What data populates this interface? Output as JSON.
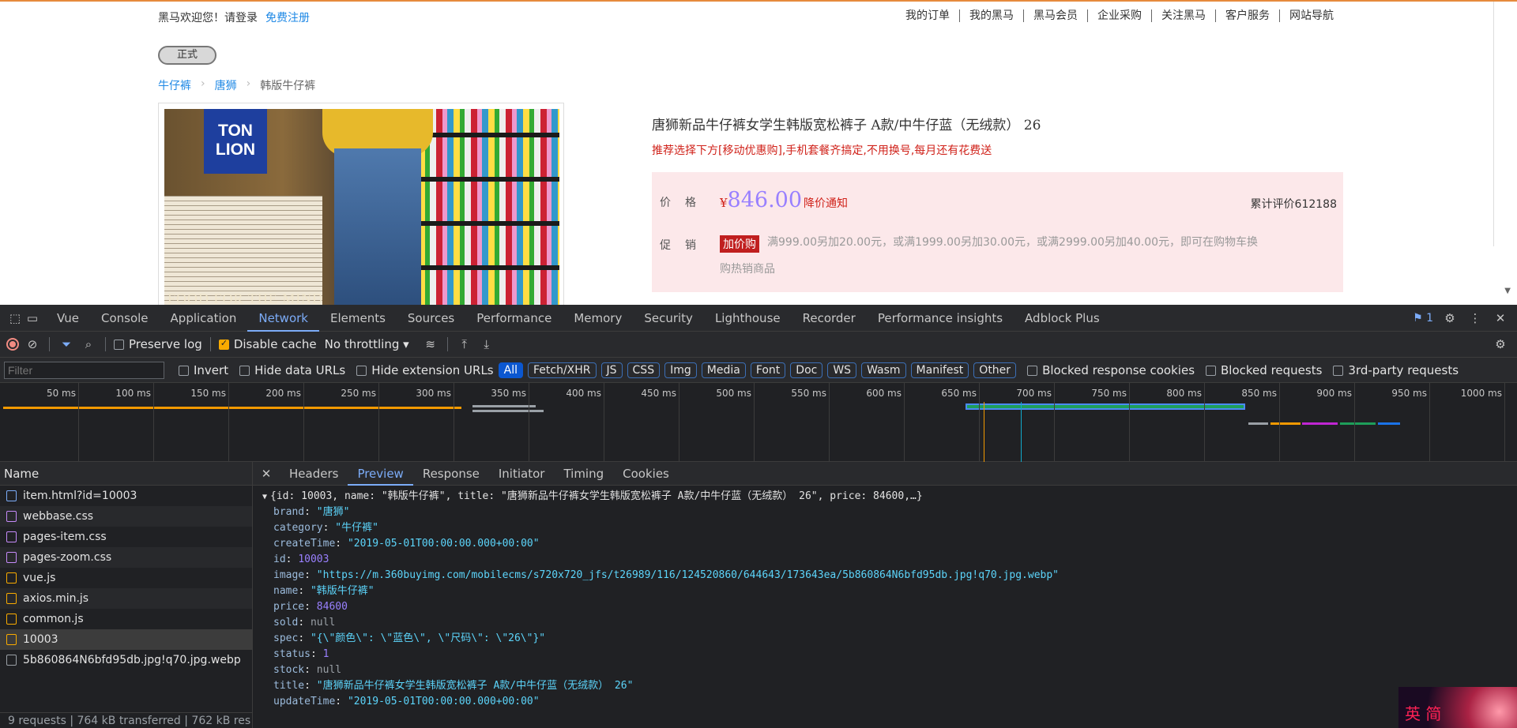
{
  "site": {
    "welcome": "黑马欢迎您！请登录",
    "register": "免费注册",
    "nav": [
      "我的订单",
      "我的黑马",
      "黑马会员",
      "企业采购",
      "关注黑马",
      "客户服务",
      "网站导航"
    ],
    "env_button": "正式",
    "breadcrumb": [
      "牛仔裤",
      "唐狮",
      "韩版牛仔裤"
    ],
    "image": {
      "logo_line1": "TON",
      "logo_line2": "LION",
      "bottom_text": "FOOD FOR THE MIND"
    },
    "product_title": "唐狮新品牛仔裤女学生韩版宽松裤子 A款/中牛仔蓝（无绒款） 26",
    "promo_line": "推荐选择下方[移动优惠购],手机套餐齐搞定,不用换号,每月还有花费送",
    "price_label": "价格",
    "currency": "¥",
    "price": "846.00",
    "price_notice": "降价通知",
    "reviews": "累计评价612188",
    "promo_label": "促销",
    "promo_tag": "加价购",
    "promo_text": "满999.00另加20.00元，或满1999.00另加30.00元，或满2999.00另加40.00元，即可在购物车换 购热销商品"
  },
  "devtools": {
    "tabs": [
      "Vue",
      "Console",
      "Application",
      "Network",
      "Elements",
      "Sources",
      "Performance",
      "Memory",
      "Security",
      "Lighthouse",
      "Recorder",
      "Performance insights",
      "Adblock Plus"
    ],
    "active_tab": "Network",
    "issues_count": "1",
    "toolbar": {
      "preserve_log": "Preserve log",
      "disable_cache": "Disable cache",
      "throttling": "No throttling"
    },
    "filter": {
      "placeholder": "Filter",
      "invert": "Invert",
      "hide_data_urls": "Hide data URLs",
      "hide_extension_urls": "Hide extension URLs",
      "types": [
        "All",
        "Fetch/XHR",
        "JS",
        "CSS",
        "Img",
        "Media",
        "Font",
        "Doc",
        "WS",
        "Wasm",
        "Manifest",
        "Other"
      ],
      "blocked_cookies": "Blocked response cookies",
      "blocked_requests": "Blocked requests",
      "third_party": "3rd-party requests"
    },
    "timeline_ticks": [
      "50 ms",
      "100 ms",
      "150 ms",
      "200 ms",
      "250 ms",
      "300 ms",
      "350 ms",
      "400 ms",
      "450 ms",
      "500 ms",
      "550 ms",
      "600 ms",
      "650 ms",
      "700 ms",
      "750 ms",
      "800 ms",
      "850 ms",
      "900 ms",
      "950 ms",
      "1000 ms"
    ],
    "name_header": "Name",
    "requests": [
      {
        "name": "item.html?id=10003",
        "type": "doc",
        "color": "#7cacf8"
      },
      {
        "name": "webbase.css",
        "type": "css",
        "color": "#c58af9"
      },
      {
        "name": "pages-item.css",
        "type": "css",
        "color": "#c58af9"
      },
      {
        "name": "pages-zoom.css",
        "type": "css",
        "color": "#c58af9"
      },
      {
        "name": "vue.js",
        "type": "js",
        "color": "#f9ab00"
      },
      {
        "name": "axios.min.js",
        "type": "js",
        "color": "#f9ab00"
      },
      {
        "name": "common.js",
        "type": "js",
        "color": "#f9ab00"
      },
      {
        "name": "10003",
        "type": "xhr",
        "color": "#f9ab00"
      },
      {
        "name": "5b860864N6bfd95db.jpg!q70.jpg.webp",
        "type": "img",
        "color": "#9aa0a6"
      }
    ],
    "status": "9 requests  |  764 kB transferred  |  762 kB res",
    "detail_tabs": [
      "Headers",
      "Preview",
      "Response",
      "Initiator",
      "Timing",
      "Cookies"
    ],
    "active_detail_tab": "Preview",
    "preview": {
      "summary": "{id: 10003, name: \"韩版牛仔裤\", title: \"唐狮新品牛仔裤女学生韩版宽松裤子 A款/中牛仔蓝（无绒款） 26\", price: 84600,…}",
      "fields": [
        {
          "key": "brand",
          "value": "\"唐狮\"",
          "kind": "str"
        },
        {
          "key": "category",
          "value": "\"牛仔裤\"",
          "kind": "str"
        },
        {
          "key": "createTime",
          "value": "\"2019-05-01T00:00:00.000+00:00\"",
          "kind": "str"
        },
        {
          "key": "id",
          "value": "10003",
          "kind": "num"
        },
        {
          "key": "image",
          "value": "\"https://m.360buyimg.com/mobilecms/s720x720_jfs/t26989/116/124520860/644643/173643ea/5b860864N6bfd95db.jpg!q70.jpg.webp\"",
          "kind": "str"
        },
        {
          "key": "name",
          "value": "\"韩版牛仔裤\"",
          "kind": "str"
        },
        {
          "key": "price",
          "value": "84600",
          "kind": "num"
        },
        {
          "key": "sold",
          "value": "null",
          "kind": "nul"
        },
        {
          "key": "spec",
          "value": "\"{\\\"颜色\\\": \\\"蓝色\\\", \\\"尺码\\\": \\\"26\\\"}\"",
          "kind": "str"
        },
        {
          "key": "status",
          "value": "1",
          "kind": "num"
        },
        {
          "key": "stock",
          "value": "null",
          "kind": "nul"
        },
        {
          "key": "title",
          "value": "\"唐狮新品牛仔裤女学生韩版宽松裤子 A款/中牛仔蓝（无绒款） 26\"",
          "kind": "str"
        },
        {
          "key": "updateTime",
          "value": "\"2019-05-01T00:00:00.000+00:00\"",
          "kind": "str"
        }
      ]
    },
    "ad_text": "英 简"
  }
}
